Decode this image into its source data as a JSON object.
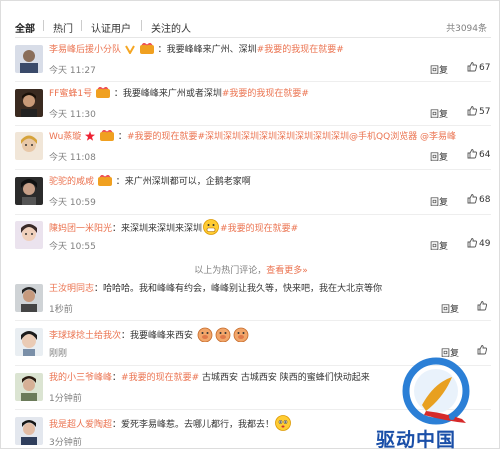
{
  "tabs": [
    "全部",
    "热门",
    "认证用户",
    "关注的人"
  ],
  "total_count": "共3094条",
  "reply_label": "回复",
  "hot_divider": {
    "text": "以上为热门评论，",
    "more": "查看更多»"
  },
  "watermark": {
    "text": "驱动中国"
  },
  "colors": {
    "accent": "#eb7350",
    "muted": "#808080"
  },
  "comments": [
    {
      "user": "李易峰后援小分队",
      "badges": [
        "verified-v-icon",
        "vip-icon"
      ],
      "separator": "：",
      "text_before": "我要峰峰来广州、深圳",
      "tag": "#我要的我现在就要#",
      "text_after": "",
      "time": "今天 11:27",
      "likes": "67"
    },
    {
      "user": "FF蜜蜂1号",
      "badges": [
        "vip-icon"
      ],
      "separator": "：",
      "text_before": "我要峰峰来广州或者深圳",
      "tag": "#我要的我现在就要#",
      "text_after": "",
      "time": "今天 11:30",
      "likes": "57"
    },
    {
      "user": "Wu蒸璇",
      "badges": [
        "star-icon",
        "vip-icon"
      ],
      "separator": "：",
      "text_before": "",
      "tag": "#我要的现在就要#深圳深圳深圳深圳深圳深圳深圳深圳@手机QQ浏览器 @李易峰",
      "text_after": "",
      "time": "今天 11:08",
      "likes": "64"
    },
    {
      "user": "驼驼的咸咸",
      "badges": [
        "vip-icon"
      ],
      "separator": "：",
      "text_before": "来广州深圳都可以，企鹅老家啊",
      "tag": "",
      "text_after": "",
      "time": "今天 10:59",
      "likes": "68"
    },
    {
      "user": "陳妈团一米阳光",
      "badges": [],
      "separator": "：",
      "text_before": "来深圳来深圳来深圳",
      "tag": "#我要的现在就要#",
      "text_after": "",
      "time": "今天 10:55",
      "likes": "49"
    },
    {
      "user": "王汝明同志",
      "badges": [],
      "separator": "：",
      "text_before": "哈哈哈。我和峰峰有约会，峰峰别让我久等，快来吧，我在大北京等你",
      "tag": "",
      "text_after": "",
      "time": "1秒前",
      "likes": ""
    },
    {
      "user": "李球球捻土给我次",
      "badges": [],
      "separator": "：",
      "text_before": "我要峰峰来西安",
      "tag": "",
      "text_after": "",
      "time": "刚刚",
      "likes": ""
    },
    {
      "user": "我的小三爷峰峰",
      "badges": [],
      "separator": "：",
      "text_before": "",
      "tag": "#我要的现在就要#",
      "text_after": "古城西安 古城西安 陕西的蜜蜂们快动起来",
      "time": "1分钟前",
      "likes": ""
    },
    {
      "user": "我是超人爱陶超",
      "badges": [],
      "separator": "：",
      "text_before": "爱死李易峰惹。去哪儿都行，我都去！",
      "tag": "",
      "text_after": "",
      "time": "3分钟前",
      "likes": ""
    }
  ]
}
